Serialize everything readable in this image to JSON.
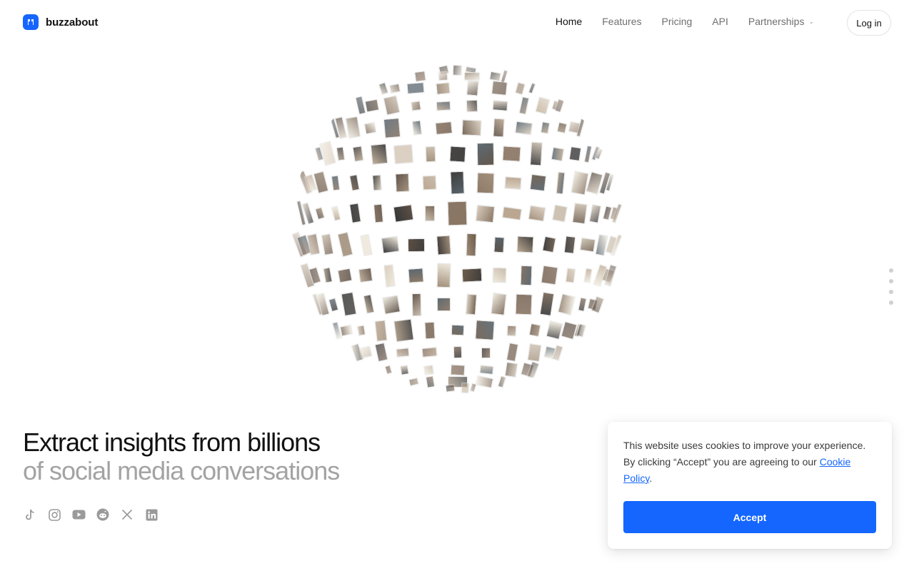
{
  "brand": {
    "name": "buzzabout",
    "accent": "#1466ff"
  },
  "nav": {
    "items": [
      {
        "label": "Home",
        "active": true
      },
      {
        "label": "Features",
        "active": false
      },
      {
        "label": "Pricing",
        "active": false
      },
      {
        "label": "API",
        "active": false
      },
      {
        "label": "Partnerships",
        "active": false,
        "has_dropdown": true
      }
    ],
    "login_label": "Log in"
  },
  "hero": {
    "title": "Extract insights from billions",
    "subtitle": "of social media conversations"
  },
  "socials": [
    "tiktok-icon",
    "instagram-icon",
    "youtube-icon",
    "reddit-icon",
    "x-icon",
    "linkedin-icon"
  ],
  "cookie": {
    "text_before": "This website uses cookies to improve your experience. By clicking “Accept” you are agreeing to our ",
    "link_text": "Cookie Policy",
    "text_after": ".",
    "accept_label": "Accept"
  }
}
